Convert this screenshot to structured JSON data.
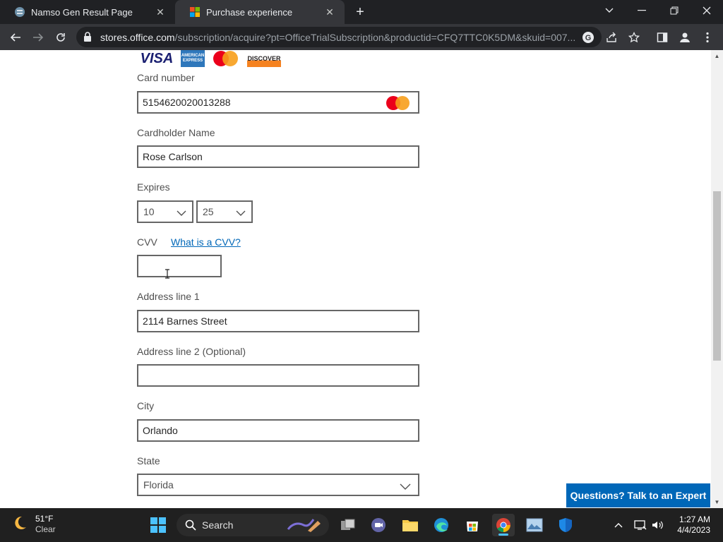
{
  "browser": {
    "tabs": [
      {
        "title": "Namso Gen Result Page",
        "active": false
      },
      {
        "title": "Purchase experience",
        "active": true
      }
    ],
    "url": {
      "host": "stores.office.com",
      "path": "/subscription/acquire?pt=OfficeTrialSubscription&productid=CFQ7TTC0K5DM&skuid=007..."
    }
  },
  "card_logos": [
    "VISA",
    "AMERICAN EXPRESS",
    "Mastercard",
    "DISCOVER"
  ],
  "form": {
    "card_number": {
      "label": "Card number",
      "value": "5154620020013288"
    },
    "cardholder": {
      "label": "Cardholder Name",
      "value": "Rose Carlson"
    },
    "expires": {
      "label": "Expires",
      "month": "10",
      "year": "25"
    },
    "cvv": {
      "label": "CVV",
      "help_link": "What is a CVV?",
      "value": ""
    },
    "address1": {
      "label": "Address line 1",
      "value": "2114 Barnes Street"
    },
    "address2": {
      "label": "Address line 2 (Optional)",
      "value": ""
    },
    "city": {
      "label": "City",
      "value": "Orlando"
    },
    "state": {
      "label": "State",
      "value": "Florida"
    }
  },
  "expert_button": "Questions? Talk to an Expert",
  "taskbar": {
    "weather": {
      "temp": "51°F",
      "condition": "Clear"
    },
    "search_label": "Search",
    "time": "1:27 AM",
    "date": "4/4/2023"
  },
  "colors": {
    "accent": "#0067b8",
    "chrome_dark": "#202124",
    "chrome_toolbar": "#35363a"
  }
}
